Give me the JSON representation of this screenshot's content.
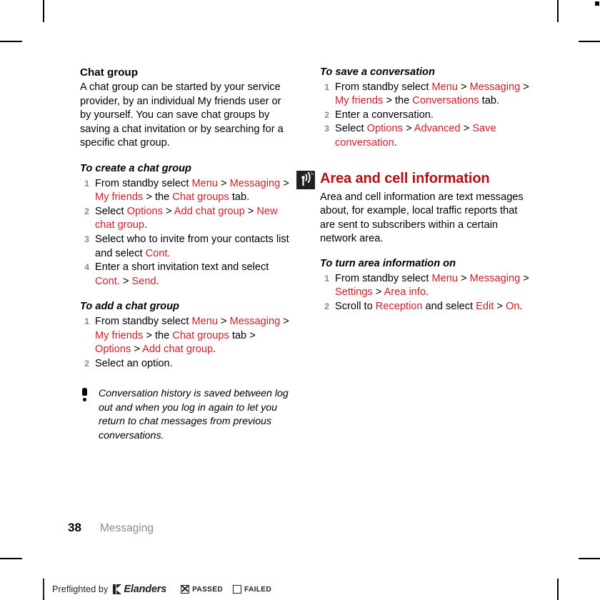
{
  "page": {
    "folio": "38",
    "chapter_footer": "Messaging"
  },
  "left_column": {
    "section_heading": "Chat group",
    "intro_paragraph": "A chat group can be started by your service provider, by an individual My friends user or by yourself. You can save chat groups by saving a chat invitation or by searching for a specific chat group.",
    "procedure_1": {
      "title": "To create a chat group",
      "steps": [
        {
          "parts": [
            {
              "t": "From standby select ",
              "ui": false
            },
            {
              "t": "Menu",
              "ui": true
            },
            {
              "t": " > ",
              "ui": false
            },
            {
              "t": "Messaging",
              "ui": true
            },
            {
              "t": " > ",
              "ui": false
            },
            {
              "t": "My friends",
              "ui": true
            },
            {
              "t": " > the ",
              "ui": false
            },
            {
              "t": "Chat groups",
              "ui": true
            },
            {
              "t": " tab.",
              "ui": false
            }
          ]
        },
        {
          "parts": [
            {
              "t": "Select ",
              "ui": false
            },
            {
              "t": "Options",
              "ui": true
            },
            {
              "t": " > ",
              "ui": false
            },
            {
              "t": "Add chat group",
              "ui": true
            },
            {
              "t": " > ",
              "ui": false
            },
            {
              "t": "New chat group",
              "ui": true
            },
            {
              "t": ".",
              "ui": false
            }
          ]
        },
        {
          "parts": [
            {
              "t": "Select who to invite from your contacts list and select ",
              "ui": false
            },
            {
              "t": "Cont.",
              "ui": true
            }
          ]
        },
        {
          "parts": [
            {
              "t": "Enter a short invitation text and select ",
              "ui": false
            },
            {
              "t": "Cont.",
              "ui": true
            },
            {
              "t": " > ",
              "ui": false
            },
            {
              "t": "Send",
              "ui": true
            },
            {
              "t": ".",
              "ui": false
            }
          ]
        }
      ]
    },
    "procedure_2": {
      "title": "To add a chat group",
      "steps": [
        {
          "parts": [
            {
              "t": "From standby select ",
              "ui": false
            },
            {
              "t": "Menu",
              "ui": true
            },
            {
              "t": " > ",
              "ui": false
            },
            {
              "t": "Messaging",
              "ui": true
            },
            {
              "t": " > ",
              "ui": false
            },
            {
              "t": "My friends",
              "ui": true
            },
            {
              "t": " > the ",
              "ui": false
            },
            {
              "t": "Chat groups",
              "ui": true
            },
            {
              "t": " tab > ",
              "ui": false
            },
            {
              "t": "Options",
              "ui": true
            },
            {
              "t": " > ",
              "ui": false
            },
            {
              "t": "Add chat group",
              "ui": true
            },
            {
              "t": ".",
              "ui": false
            }
          ]
        },
        {
          "parts": [
            {
              "t": "Select an option.",
              "ui": false
            }
          ]
        }
      ]
    },
    "note": {
      "icon": "exclamation-icon",
      "text": "Conversation history is saved between log out and when you log in again to let you return to chat messages from previous conversations."
    }
  },
  "right_column": {
    "procedure_1": {
      "title": "To save a conversation",
      "steps": [
        {
          "parts": [
            {
              "t": "From standby select ",
              "ui": false
            },
            {
              "t": "Menu",
              "ui": true
            },
            {
              "t": " > ",
              "ui": false
            },
            {
              "t": "Messaging",
              "ui": true
            },
            {
              "t": " > ",
              "ui": false
            },
            {
              "t": "My friends",
              "ui": true
            },
            {
              "t": " > the ",
              "ui": false
            },
            {
              "t": "Conversations",
              "ui": true
            },
            {
              "t": " tab.",
              "ui": false
            }
          ]
        },
        {
          "parts": [
            {
              "t": "Enter a conversation.",
              "ui": false
            }
          ]
        },
        {
          "parts": [
            {
              "t": "Select ",
              "ui": false
            },
            {
              "t": "Options",
              "ui": true
            },
            {
              "t": " > ",
              "ui": false
            },
            {
              "t": "Advanced",
              "ui": true
            },
            {
              "t": " > ",
              "ui": false
            },
            {
              "t": "Save conversation",
              "ui": true
            },
            {
              "t": ".",
              "ui": false
            }
          ]
        }
      ]
    },
    "chapter": {
      "icon": "broadcast-antenna-icon",
      "title": "Area and cell information",
      "intro_paragraph": "Area and cell information are text messages about, for example, local traffic reports that are sent to subscribers within a certain network area."
    },
    "procedure_2": {
      "title": "To turn area information on",
      "steps": [
        {
          "parts": [
            {
              "t": "From standby select ",
              "ui": false
            },
            {
              "t": "Menu",
              "ui": true
            },
            {
              "t": " > ",
              "ui": false
            },
            {
              "t": "Messaging",
              "ui": true
            },
            {
              "t": " > ",
              "ui": false
            },
            {
              "t": "Settings",
              "ui": true
            },
            {
              "t": " > ",
              "ui": false
            },
            {
              "t": "Area info",
              "ui": true
            },
            {
              "t": ".",
              "ui": false
            }
          ]
        },
        {
          "parts": [
            {
              "t": "Scroll to ",
              "ui": false
            },
            {
              "t": "Reception",
              "ui": true
            },
            {
              "t": " and select ",
              "ui": false
            },
            {
              "t": "Edit",
              "ui": true
            },
            {
              "t": " > ",
              "ui": false
            },
            {
              "t": "On",
              "ui": true
            },
            {
              "t": ".",
              "ui": false
            }
          ]
        }
      ]
    }
  },
  "preflight": {
    "label": "Preflighted by",
    "brand": "Elanders",
    "passed_label": "PASSED",
    "passed_checked": true,
    "failed_label": "FAILED",
    "failed_checked": false
  },
  "colors": {
    "ui_term_red": "#c8202b",
    "chapter_heading_red": "#b11116",
    "step_number_grey": "#8b8b8b",
    "footer_chapter_grey": "#8b8b8b",
    "ink_black": "#000000",
    "preflight_ink": "#231f20"
  }
}
